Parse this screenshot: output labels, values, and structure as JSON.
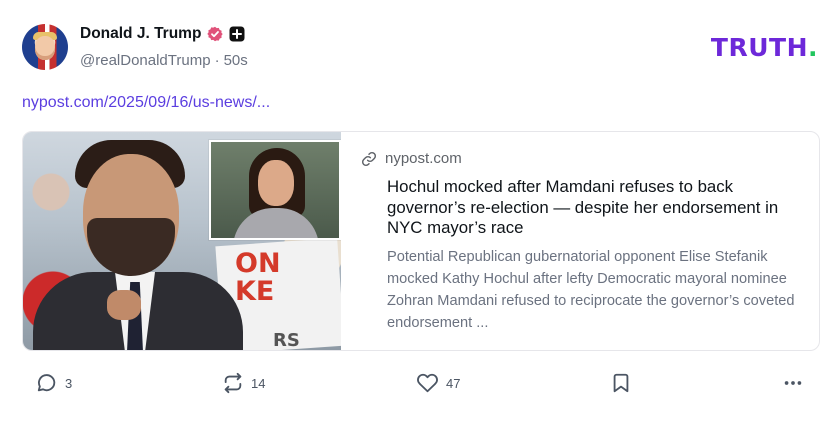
{
  "author": {
    "name": "Donald J. Trump",
    "handle": "@realDonaldTrump",
    "separator": "·",
    "time": "50s"
  },
  "brand": {
    "text": "TRUTH",
    "dot": ".",
    "color": "#6d28d9",
    "dot_color": "#22c55e"
  },
  "post": {
    "link_text": "nypost.com/2025/09/16/us-news/..."
  },
  "card": {
    "source": "nypost.com",
    "headline": "Hochul mocked after Mamdani refuses to back governor’s re-election — despite her endorsement in NYC mayor’s race",
    "description": "Potential Republican gubernatorial opponent Elise Stefanik mocked Kathy Hochul after lefty Democratic mayoral nominee Zohran Mamdani refused to reciprocate the governor’s coveted endorsement ...",
    "image_sign_text": "ON\nKE",
    "image_sign_text2": "RS"
  },
  "actions": {
    "replies": "3",
    "retruths": "14",
    "likes": "47"
  },
  "icons": {
    "verified": "verified-badge-icon",
    "plus": "plus-badge-icon",
    "link": "link-icon",
    "reply": "comment-icon",
    "retruth": "retruth-icon",
    "like": "heart-icon",
    "bookmark": "bookmark-icon",
    "more": "more-icon"
  },
  "colors": {
    "link": "#5b3ee0",
    "verified": "#e0527a"
  }
}
